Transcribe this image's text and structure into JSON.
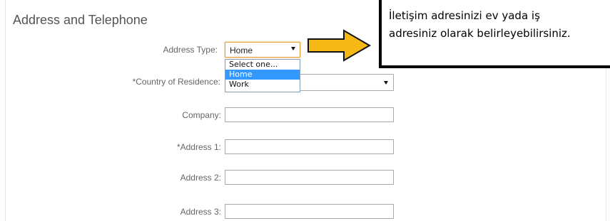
{
  "section": {
    "title": "Address and Telephone"
  },
  "form": {
    "address_type": {
      "label": "Address Type:",
      "value": "Home",
      "options": [
        "Select one...",
        "Home",
        "Work"
      ]
    },
    "country": {
      "label": "*Country of Residence:",
      "value": ""
    },
    "company": {
      "label": "Company:",
      "value": ""
    },
    "address1": {
      "label": "*Address 1:",
      "value": ""
    },
    "address2": {
      "label": "Address 2:",
      "value": ""
    },
    "address3": {
      "label": "Address 3:",
      "value": ""
    }
  },
  "annotation": {
    "line1": "İletişim adresinizi ev yada iş",
    "line2": "adresiniz olarak belirleyebilirsiniz.",
    "arrow_color": "#f5b815"
  }
}
